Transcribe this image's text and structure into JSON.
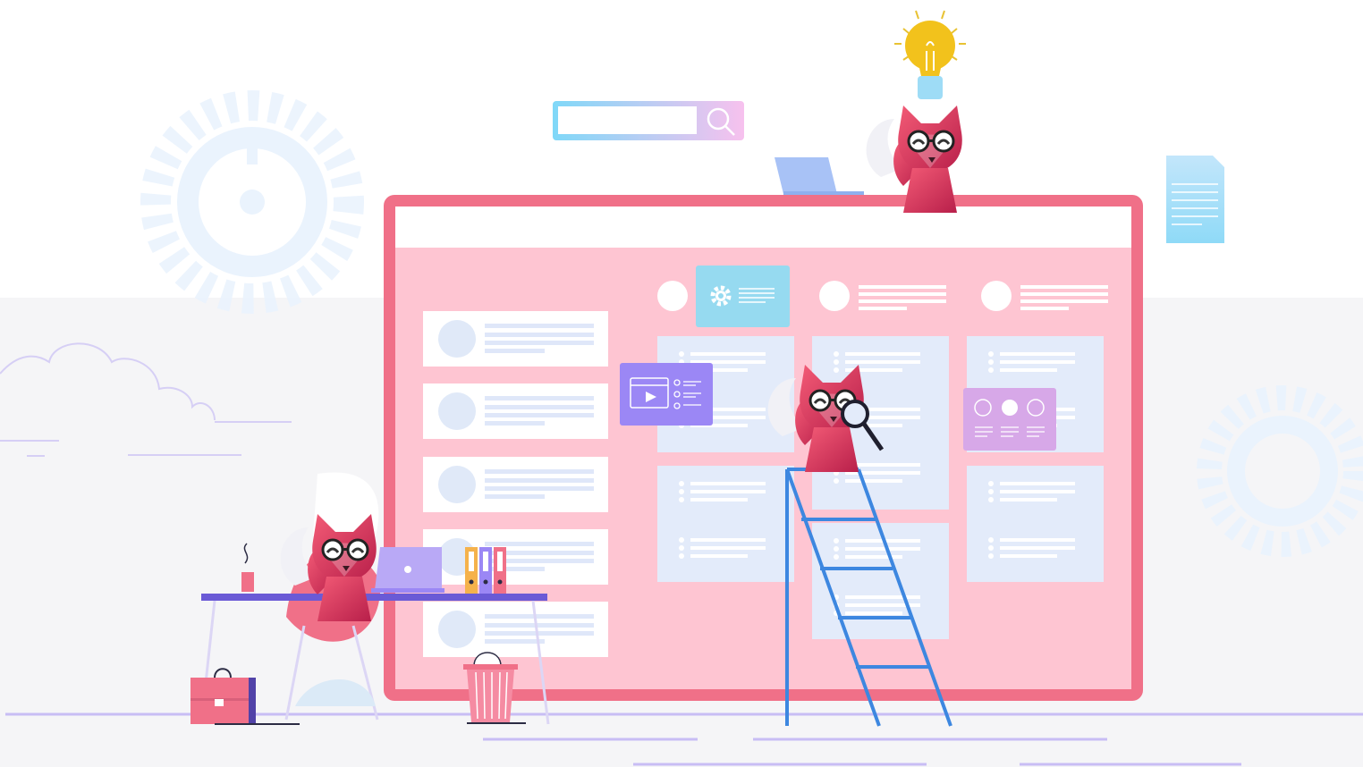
{
  "scene": {
    "subject": "kanban-board-illustration",
    "search_bar": {
      "value": "",
      "placeholder": ""
    },
    "board": {
      "left_cards": 5,
      "columns": 3
    },
    "colors": {
      "board_frame": "#f07088",
      "board_fill": "#fec5d2",
      "card_fill": "#e3ebfa",
      "accent_blue": "#3d87e0",
      "accent_purple": "#9b87f5",
      "gear": "#eaf3fd",
      "fox": "#e8405f"
    },
    "icons": [
      "gear-icon",
      "search-icon",
      "lightbulb-icon",
      "document-icon",
      "video-widget-icon",
      "clock-widget-icon",
      "laptop-icon",
      "magnifier-icon",
      "ladder-icon",
      "desk-icon",
      "briefcase-icon",
      "trash-bin-icon",
      "cloud-icon",
      "folder-binders-icon"
    ]
  }
}
